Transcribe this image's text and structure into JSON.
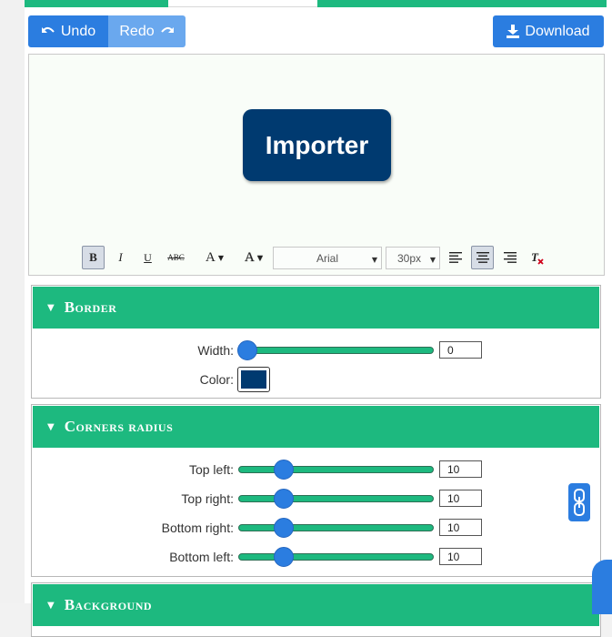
{
  "toolbar": {
    "undo_label": "Undo",
    "redo_label": "Redo",
    "download_label": "Download"
  },
  "preview": {
    "button_text": "Importer",
    "button_color": "#003a70"
  },
  "text_toolbar": {
    "bold": "B",
    "italic": "I",
    "underline": "U",
    "strike": "ABC",
    "font_color": "A",
    "bg_color": "A",
    "font_family": "Arial",
    "font_size": "30px",
    "clear_format": "Tx",
    "active_alignment": "center"
  },
  "border_panel": {
    "title": "Border",
    "width_label": "Width:",
    "width_value": "0",
    "color_label": "Color:",
    "color_value": "#003a70"
  },
  "corners_panel": {
    "title": "Corners radius",
    "rows": [
      {
        "label": "Top left:",
        "value": "10"
      },
      {
        "label": "Top right:",
        "value": "10"
      },
      {
        "label": "Bottom right:",
        "value": "10"
      },
      {
        "label": "Bottom left:",
        "value": "10"
      }
    ]
  },
  "background_panel": {
    "title": "Background"
  },
  "colors": {
    "accent_green": "#1db97f",
    "primary_blue": "#2b7de0",
    "light_blue": "#6aa8ee"
  }
}
